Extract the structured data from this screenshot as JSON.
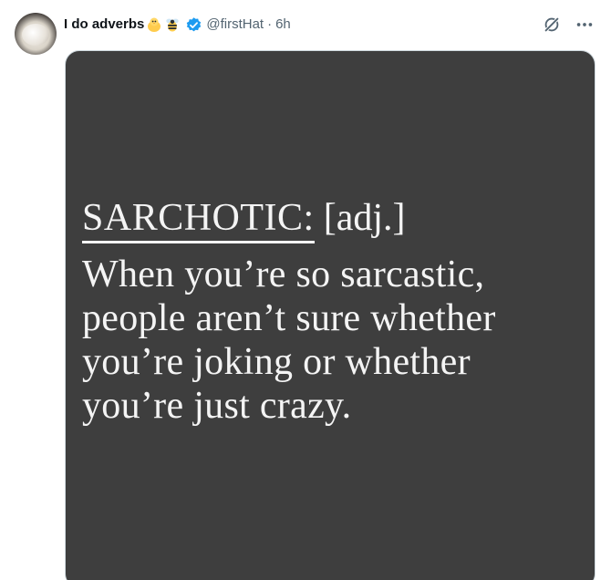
{
  "tweet": {
    "display_name": "I do adverbs",
    "emojis": [
      "chick-emoji",
      "bee-emoji"
    ],
    "handle": "@firstHat",
    "separator": "·",
    "time": "6h",
    "verified": true
  },
  "actions": {
    "grok_icon": "grok-icon",
    "more_icon": "more-icon"
  },
  "media": {
    "term": "SARCHOTIC:",
    "part_of_speech": "[adj.]",
    "definition_lines": [
      "When you’re so sarcastic,",
      "people aren’t sure whether",
      "you’re joking or whether",
      "you’re just crazy."
    ]
  },
  "colors": {
    "verified_blue": "#1d9bf0",
    "handle_gray": "#536471",
    "media_background": "#3e3e3e",
    "media_text": "#f4f4f4"
  }
}
